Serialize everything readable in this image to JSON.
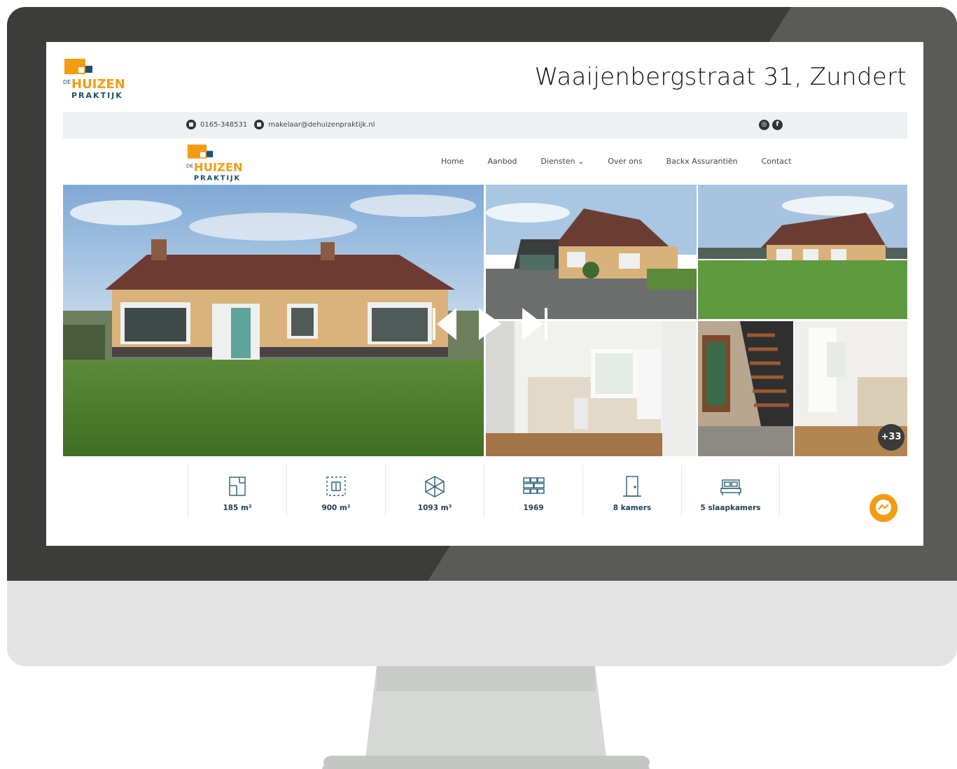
{
  "listing": {
    "address": "Waaijenbergstraat 31, Zundert"
  },
  "brand": {
    "logo_de": "DE",
    "logo_huizen": "HUIZEN",
    "logo_praktijk": "PRAKTIJK",
    "orange": "#f39c12",
    "blue": "#1d4f6e"
  },
  "topbar": {
    "phone": "0165-348531",
    "email": "makelaar@dehuizenpraktijk.nl",
    "socials": [
      "instagram-icon",
      "facebook-icon"
    ]
  },
  "nav": {
    "items": [
      {
        "label": "Home"
      },
      {
        "label": "Aanbod"
      },
      {
        "label": "Diensten ⌄"
      },
      {
        "label": "Over ons"
      },
      {
        "label": "Backx Assurantiën"
      },
      {
        "label": "Contact"
      }
    ]
  },
  "gallery": {
    "more_photos": "+33"
  },
  "stats": [
    {
      "icon": "floor-area-icon",
      "value": "185 m²"
    },
    {
      "icon": "plot-area-icon",
      "value": "900 m²"
    },
    {
      "icon": "volume-cube-icon",
      "value": "1093 m³"
    },
    {
      "icon": "brick-wall-icon",
      "value": "1969"
    },
    {
      "icon": "door-icon",
      "value": "8 kamers"
    },
    {
      "icon": "bed-icon",
      "value": "5 slaapkamers"
    }
  ]
}
